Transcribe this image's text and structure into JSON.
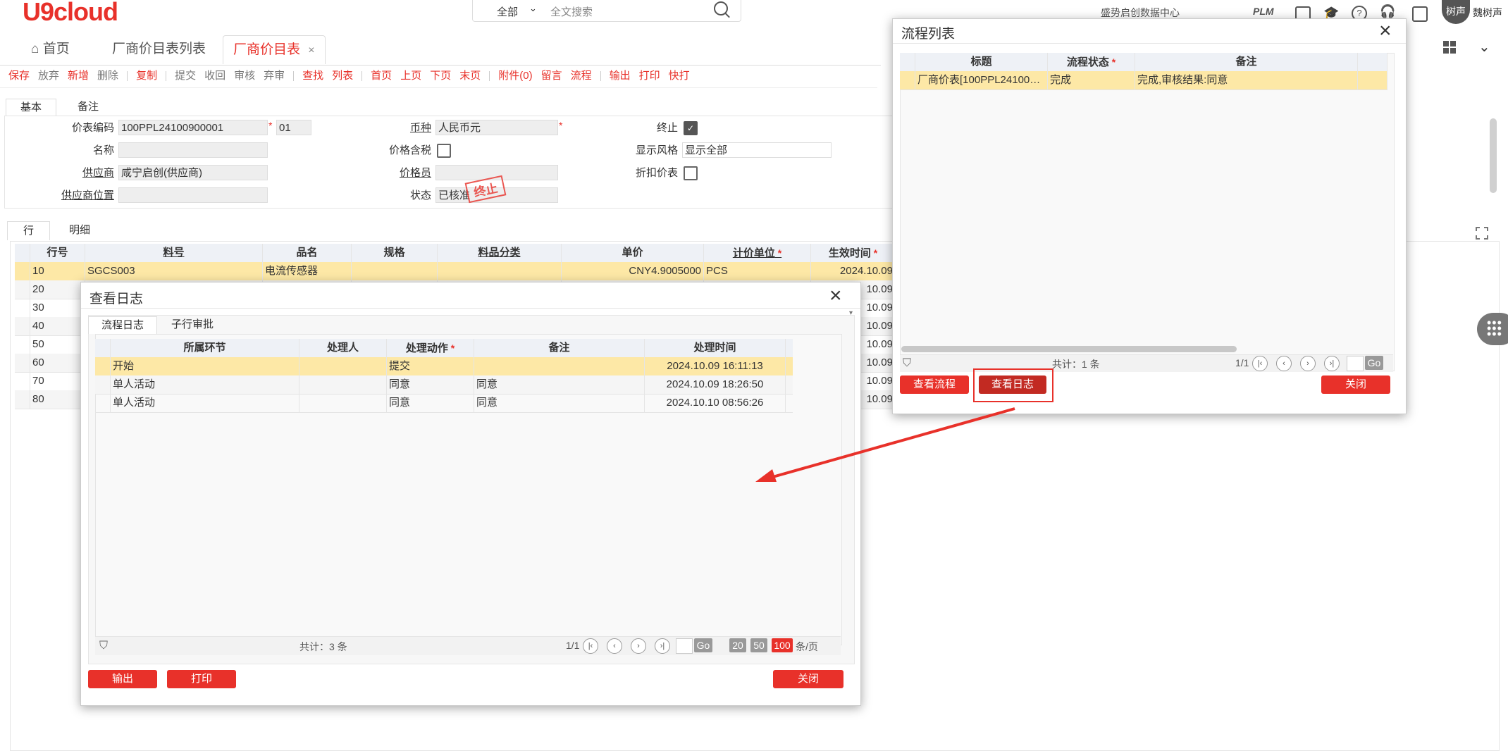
{
  "header": {
    "logo": "U9cloud",
    "search_scope": "全部",
    "search_placeholder": "全文搜索",
    "org": "盛势启创数据中心",
    "plm": "PLM",
    "avatar_text": "树声",
    "user": "魏树声"
  },
  "tabs": [
    {
      "label": "首页",
      "icon": "home-icon"
    },
    {
      "label": "厂商价目表列表"
    },
    {
      "label": "厂商价目表",
      "active": true
    }
  ],
  "toolbar": [
    {
      "label": "保存",
      "color": "red"
    },
    {
      "label": "放弃",
      "color": "gray"
    },
    {
      "label": "新增",
      "color": "red"
    },
    {
      "label": "删除",
      "color": "gray"
    },
    {
      "sep": true
    },
    {
      "label": "复制",
      "color": "red"
    },
    {
      "sep": true
    },
    {
      "label": "提交",
      "color": "gray"
    },
    {
      "label": "收回",
      "color": "gray"
    },
    {
      "label": "审核",
      "color": "gray"
    },
    {
      "label": "弃审",
      "color": "gray"
    },
    {
      "sep": true
    },
    {
      "label": "查找",
      "color": "red"
    },
    {
      "label": "列表",
      "color": "red"
    },
    {
      "sep": true
    },
    {
      "label": "首页",
      "color": "red"
    },
    {
      "label": "上页",
      "color": "red"
    },
    {
      "label": "下页",
      "color": "red"
    },
    {
      "label": "末页",
      "color": "red"
    },
    {
      "sep": true
    },
    {
      "label": "附件(0)",
      "color": "red"
    },
    {
      "label": "留言",
      "color": "red"
    },
    {
      "label": "流程",
      "color": "red"
    },
    {
      "sep": true
    },
    {
      "label": "输出",
      "color": "red"
    },
    {
      "label": "打印",
      "color": "red"
    },
    {
      "label": "快打",
      "color": "red"
    }
  ],
  "form_tabs": {
    "basic": "基本",
    "remarks": "备注"
  },
  "form": {
    "price_code_label": "价表编码",
    "price_code": "100PPL24100900001",
    "price_code_suffix": "01",
    "name_label": "名称",
    "supplier_label": "供应商",
    "supplier": "咸宁启创(供应商)",
    "supplier_loc_label": "供应商位置",
    "currency_label": "币种",
    "currency": "人民币元",
    "tax_label": "价格含税",
    "price_clerk_label": "价格员",
    "status_label": "状态",
    "status": "已核准",
    "stamp": "终止",
    "terminate_label": "终止",
    "display_style_label": "显示风格",
    "display_style": "显示全部",
    "discount_label": "折扣价表"
  },
  "grid_tabs": {
    "rows": "行",
    "detail": "明细"
  },
  "grid": {
    "headers": [
      "行号",
      "料号",
      "品名",
      "规格",
      "料品分类",
      "单价",
      "计价单位",
      "生效时间"
    ],
    "rows": [
      {
        "no": "10",
        "item": "SGCS003",
        "name": "电流传感器",
        "spec": "",
        "cat": "",
        "price": "CNY4.9005000",
        "unit": "PCS",
        "date": "2024.10.09"
      },
      {
        "no": "20",
        "date": "10.09"
      },
      {
        "no": "30",
        "date": "10.09"
      },
      {
        "no": "40",
        "date": "10.09"
      },
      {
        "no": "50",
        "date": "10.09"
      },
      {
        "no": "60",
        "date": "10.09"
      },
      {
        "no": "70",
        "date": "10.09"
      },
      {
        "no": "80",
        "date": "10.09"
      }
    ]
  },
  "log_dialog": {
    "title": "查看日志",
    "tabs": [
      "流程日志",
      "子行审批"
    ],
    "headers": [
      "所属环节",
      "处理人",
      "处理动作",
      "备注",
      "处理时间"
    ],
    "rows": [
      {
        "step": "开始",
        "user": "",
        "action": "提交",
        "note": "",
        "time": "2024.10.09 16:11:13"
      },
      {
        "step": "单人活动",
        "user": "",
        "action": "同意",
        "note": "同意",
        "time": "2024.10.09 18:26:50"
      },
      {
        "step": "单人活动",
        "user": "",
        "action": "同意",
        "note": "同意",
        "time": "2024.10.10 08:56:26"
      }
    ],
    "total": "共计：3 条",
    "page": "1/1",
    "go": "Go",
    "sizes": [
      "20",
      "50",
      "100"
    ],
    "per_page": "条/页",
    "buttons": {
      "export": "输出",
      "print": "打印",
      "close": "关闭"
    }
  },
  "flow_dialog": {
    "title": "流程列表",
    "headers": [
      "标题",
      "流程状态",
      "备注"
    ],
    "rows": [
      {
        "title": "厂商价表[100PPL24100…",
        "status": "完成",
        "note": "完成,审核结果:同意"
      }
    ],
    "total": "共计：1 条",
    "page": "1/1",
    "go": "Go",
    "buttons": {
      "view_flow": "查看流程",
      "view_log": "查看日志",
      "close": "关闭"
    }
  },
  "colors": {
    "accent": "#e8312a",
    "selected_row": "#fde8a6"
  }
}
